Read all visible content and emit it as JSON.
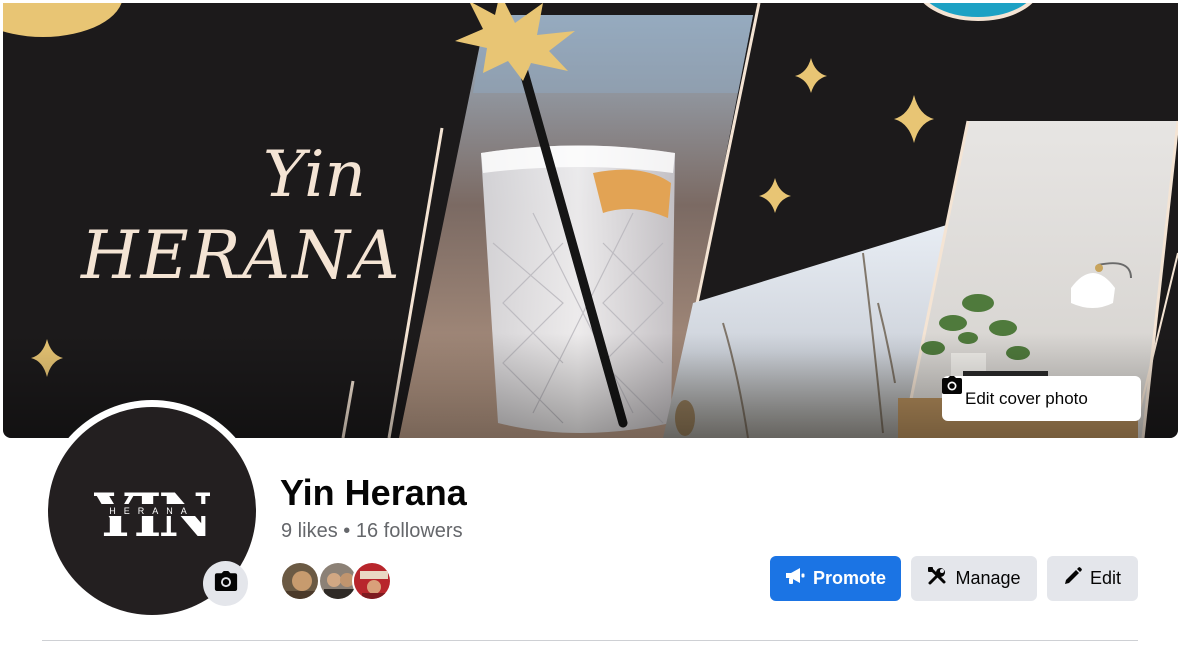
{
  "cover": {
    "title_line1": "Yin",
    "title_line2": "HERANA",
    "edit_cover_label": "Edit cover photo"
  },
  "avatar": {
    "logo_text": "YIN",
    "logo_subtext": "HERANA"
  },
  "page": {
    "name": "Yin Herana",
    "likes": "9 likes",
    "separator": "•",
    "followers": "16 followers"
  },
  "actions": {
    "promote_label": "Promote",
    "manage_label": "Manage",
    "edit_label": "Edit"
  },
  "icons": {
    "edit_cover": "camera-icon",
    "avatar_edit": "camera-icon",
    "promote": "megaphone-icon",
    "manage": "tools-icon",
    "edit": "pencil-icon"
  },
  "colors": {
    "primary": "#1b74e4",
    "secondary_button": "#e4e6eb",
    "text_primary": "#050505",
    "text_secondary": "#65676b",
    "cover_dark": "#1c1a1b",
    "cover_accent": "#e8c574",
    "cover_text": "#f4e4d4"
  }
}
